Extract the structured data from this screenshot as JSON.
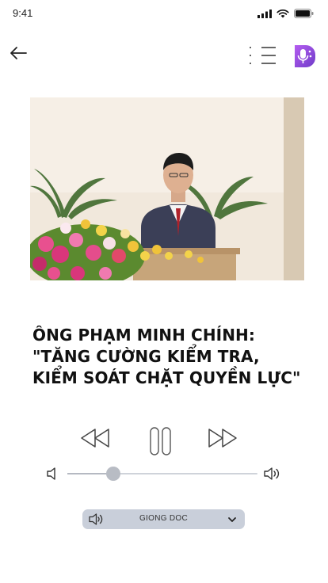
{
  "status_bar": {
    "time": "9:41"
  },
  "article": {
    "headline": "ÔNG PHẠM MINH CHÍNH: \"TĂNG CƯỜNG KIỂM TRA, KIỂM SOÁT CHẶT QUYỀN LỰC\""
  },
  "player": {
    "volume_fraction": 0.24,
    "is_playing": true
  },
  "voice_select": {
    "label": "GIONG DOC"
  },
  "icons": {
    "back": "arrow-left-icon",
    "menu": "list-menu-icon",
    "logo": "podcast-mic-logo",
    "rewind": "rewind-icon",
    "pause": "pause-icon",
    "forward": "fast-forward-icon",
    "volume_low": "volume-low-icon",
    "volume_high": "volume-high-icon",
    "chevron": "chevron-down-icon"
  },
  "colors": {
    "accent_purple": "#8a4ad6",
    "slider": "#b8bcc4",
    "select_bg": "#c9cfda"
  }
}
